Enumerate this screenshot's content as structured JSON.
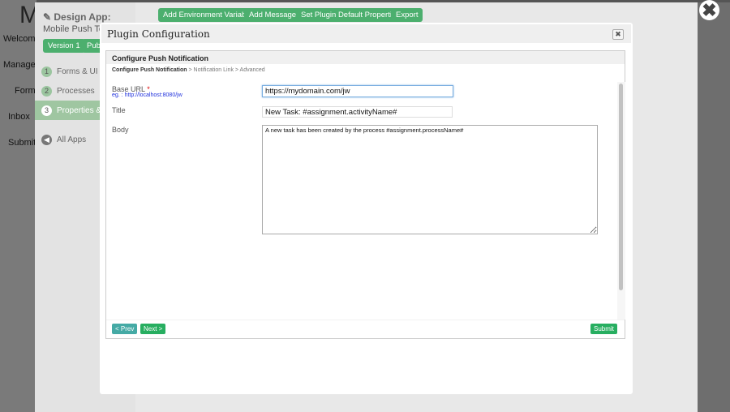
{
  "background_nav": {
    "logo": "M",
    "items": [
      "Welcome",
      "Manage F",
      "Form",
      "Inbox",
      "Submit"
    ]
  },
  "app_panel": {
    "title": "Design App:",
    "app_name": "Mobile Push Test",
    "version": "Version 1",
    "publish": "Publish",
    "steps": [
      {
        "num": "1",
        "label": "Forms & UI"
      },
      {
        "num": "2",
        "label": "Processes"
      },
      {
        "num": "3",
        "label": "Properties & Export"
      }
    ],
    "all_apps": "All Apps",
    "toolbar": [
      "Add Environment Variable",
      "Add Message",
      "Set Plugin Default Properties",
      "Export"
    ]
  },
  "dialog": {
    "title": "Plugin Configuration",
    "section_title": "Configure Push Notification",
    "breadcrumb": {
      "current": "Configure Push Notification",
      "rest": " > Notification Link > Advanced"
    },
    "fields": {
      "base_url": {
        "label": "Base URL",
        "required": "*",
        "hint": "eg. : http://localhost:8080/jw",
        "value": "https://mydomain.com/jw"
      },
      "title": {
        "label": "Title",
        "value": "New Task: #assignment.activityName#"
      },
      "body": {
        "label": "Body",
        "value": "A new task has been created by the process #assignment.processName#"
      }
    },
    "buttons": {
      "prev": "< Prev",
      "next": "Next >",
      "submit": "Submit"
    }
  },
  "colors": {
    "green": "#4caf6e",
    "button_green": "#27ae60",
    "prev_teal": "#45aaa5",
    "link_blue": "#2233dd"
  }
}
